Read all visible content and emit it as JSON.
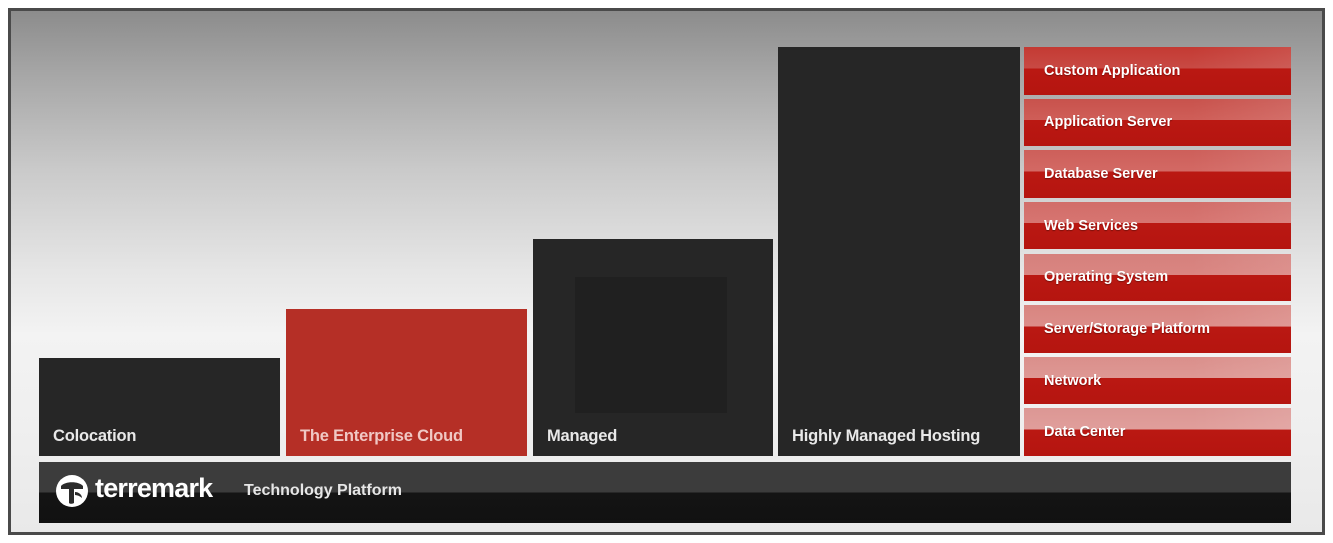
{
  "tiers": [
    {
      "label": "Colocation"
    },
    {
      "label": "The Enterprise Cloud"
    },
    {
      "label": "Managed"
    },
    {
      "label": "Highly Managed Hosting"
    }
  ],
  "stack": [
    {
      "label": "Custom Application"
    },
    {
      "label": "Application Server"
    },
    {
      "label": "Database Server"
    },
    {
      "label": "Web Services"
    },
    {
      "label": "Operating System"
    },
    {
      "label": "Server/Storage Platform"
    },
    {
      "label": "Network"
    },
    {
      "label": "Data Center"
    }
  ],
  "platform": {
    "brand": "terremark",
    "title": "Technology Platform",
    "logo_icon": "terremark-logo-icon"
  },
  "colors": {
    "dark_block": "#262626",
    "red_block": "#b52f26",
    "stack_red": "#b81713",
    "bar_dark": "#1a1a1a"
  }
}
